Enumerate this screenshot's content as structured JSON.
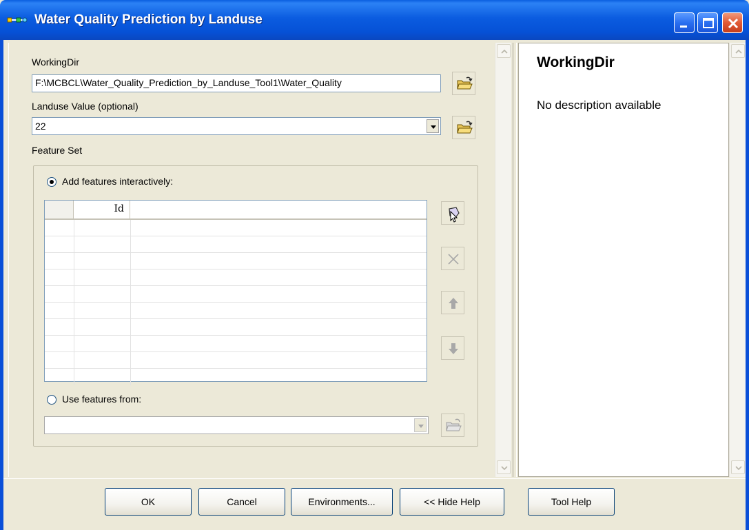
{
  "window": {
    "title": "Water Quality Prediction by Landuse",
    "accent": "#0A5FE0"
  },
  "params": {
    "working_dir_label": "WorkingDir",
    "working_dir_value": "F:\\MCBCL\\Water_Quality_Prediction_by_Landuse_Tool1\\Water_Quality",
    "landuse_label": "Landuse Value (optional)",
    "landuse_value": "22",
    "feature_set_label": "Feature Set",
    "add_interactive_label": "Add features interactively:",
    "use_features_label": "Use features from:",
    "use_features_value": ""
  },
  "grid": {
    "columns": [
      "",
      "Id",
      ""
    ],
    "rows": [
      [],
      [],
      [],
      [],
      [],
      [],
      [],
      [],
      [],
      []
    ]
  },
  "help": {
    "title": "WorkingDir",
    "description": "No description available"
  },
  "buttons": {
    "ok": "OK",
    "cancel": "Cancel",
    "environments": "Environments...",
    "hide_help": "<< Hide Help",
    "tool_help": "Tool Help"
  }
}
